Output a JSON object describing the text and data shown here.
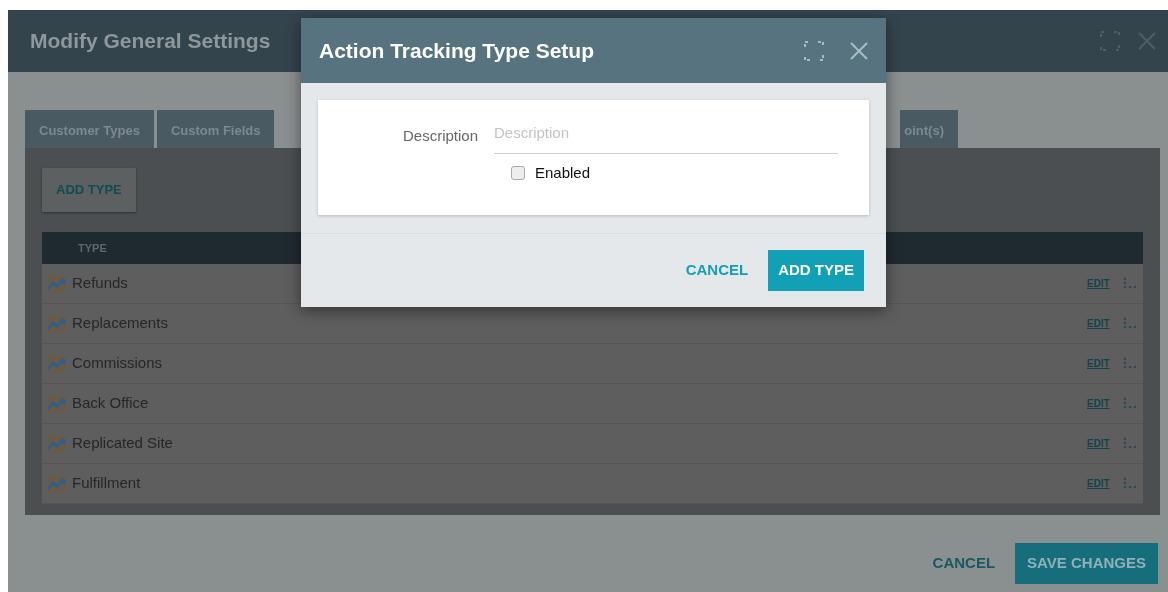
{
  "window": {
    "title": "Modify General Settings"
  },
  "tabs": [
    {
      "label": "Customer Types",
      "selected": false
    },
    {
      "label": "Custom Fields",
      "selected": false
    },
    {
      "label": "oint(s)",
      "selected": false
    }
  ],
  "add_button": "ADD TYPE",
  "table": {
    "columns": [
      "TYPE"
    ],
    "rows": [
      {
        "name": "Refunds",
        "action": "EDIT"
      },
      {
        "name": "Replacements",
        "action": "EDIT"
      },
      {
        "name": "Commissions",
        "action": "EDIT"
      },
      {
        "name": "Back Office",
        "action": "EDIT"
      },
      {
        "name": "Replicated Site",
        "action": "EDIT"
      },
      {
        "name": "Fulfillment",
        "action": "EDIT"
      }
    ]
  },
  "footer": {
    "cancel": "CANCEL",
    "save": "SAVE CHANGES"
  },
  "dialog": {
    "title": "Action Tracking Type Setup",
    "field_label": "Description",
    "placeholder": "Description",
    "checkbox": {
      "label": "Enabled",
      "checked": false
    },
    "cancel": "CANCEL",
    "submit": "ADD TYPE"
  }
}
